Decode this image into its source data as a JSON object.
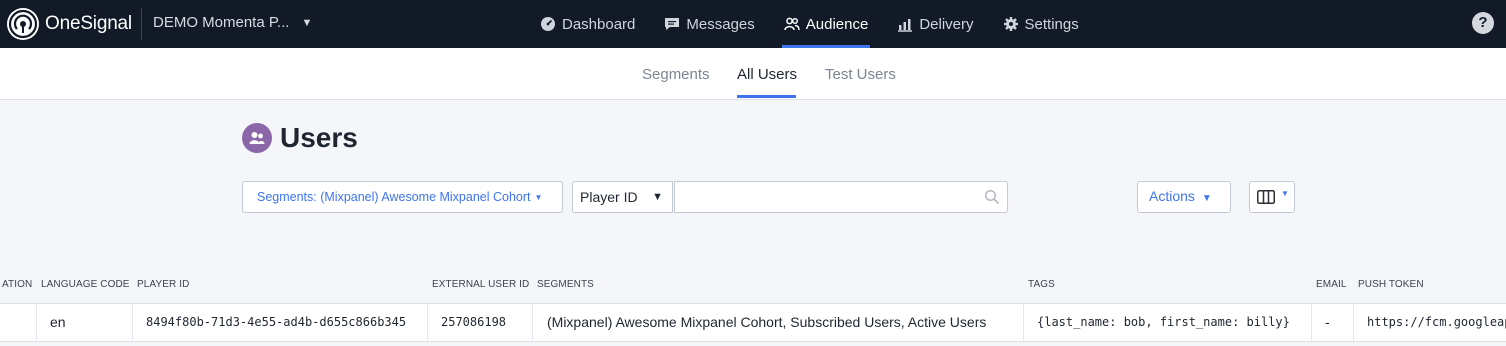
{
  "brand": {
    "name_part1": "One",
    "name_part2": "Signal"
  },
  "app_selector": {
    "label": "DEMO Momenta P..."
  },
  "nav": {
    "dashboard": "Dashboard",
    "messages": "Messages",
    "audience": "Audience",
    "delivery": "Delivery",
    "settings": "Settings"
  },
  "help_label": "?",
  "subtabs": {
    "segments": "Segments",
    "all_users": "All Users",
    "test_users": "Test Users"
  },
  "page": {
    "title": "Users"
  },
  "controls": {
    "segments_filter": "Segments:  (Mixpanel) Awesome Mixpanel Cohort",
    "id_type": "Player ID",
    "search_value": "",
    "actions_label": "Actions"
  },
  "table": {
    "headers": {
      "location": "ATION",
      "language_code": "LANGUAGE CODE",
      "player_id": "PLAYER ID",
      "external_user_id": "EXTERNAL USER ID",
      "segments": "SEGMENTS",
      "tags": "TAGS",
      "email": "EMAIL",
      "push_token": "PUSH TOKEN"
    },
    "rows": [
      {
        "location": "",
        "language_code": "en",
        "player_id": "8494f80b-71d3-4e55-ad4b-d655c866b345",
        "external_user_id": "257086198",
        "segments": "(Mixpanel) Awesome Mixpanel Cohort, Subscribed Users, Active Users",
        "tags": "{last_name: bob, first_name: billy}",
        "email": "-",
        "push_token": "https://fcm.googleapis.com"
      }
    ]
  },
  "colors": {
    "nav_bg": "#111a26",
    "accent": "#3e74f0",
    "users_badge": "#8b67a9",
    "page_bg": "#f4f6f9"
  },
  "icons": [
    "onesignal-logo-icon",
    "dashboard-icon",
    "messages-icon",
    "audience-icon",
    "delivery-icon",
    "settings-gear-icon",
    "help-icon",
    "users-icon",
    "search-icon",
    "columns-icon"
  ]
}
